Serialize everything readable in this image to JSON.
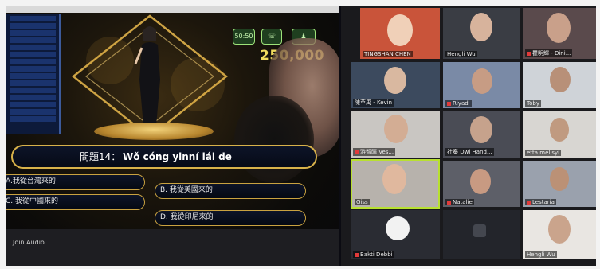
{
  "game": {
    "prize": "250,000",
    "question_number": "問題14：",
    "question_text": "Wǒ cóng yinní lái de",
    "answers": [
      {
        "id": "a",
        "label": "A.我從台灣來的"
      },
      {
        "id": "b",
        "label": "B. 我從美國來的"
      },
      {
        "id": "c",
        "label": "C. 我從中國來的"
      },
      {
        "id": "d",
        "label": "D. 我從印尼來的"
      }
    ],
    "lifelines": [
      "50:50",
      "",
      ""
    ],
    "join_audio": "Join Audio"
  },
  "gallery": {
    "participants": [
      {
        "name": "TINGSHAN CHEN"
      },
      {
        "name": "Hengli Wu"
      },
      {
        "name": "瞿明輝 - Dini..."
      },
      {
        "name": "陳苹禹 - Kevin"
      },
      {
        "name": "Riyadi"
      },
      {
        "name": "Toby"
      },
      {
        "name": "游智暉 Ves..."
      },
      {
        "name": "社泰 Dwi Hand..."
      },
      {
        "name": "etta melisyi"
      },
      {
        "name": "Giss"
      },
      {
        "name": "Natalie"
      },
      {
        "name": "Lestaria"
      },
      {
        "name": "Bakti Debbi"
      },
      {
        "name": ""
      },
      {
        "name": "Hengli Wu"
      }
    ]
  },
  "colors": {
    "prize": "#f1dc5e",
    "answer_border": "#c9a240",
    "active_speaker": "#b8e030"
  }
}
